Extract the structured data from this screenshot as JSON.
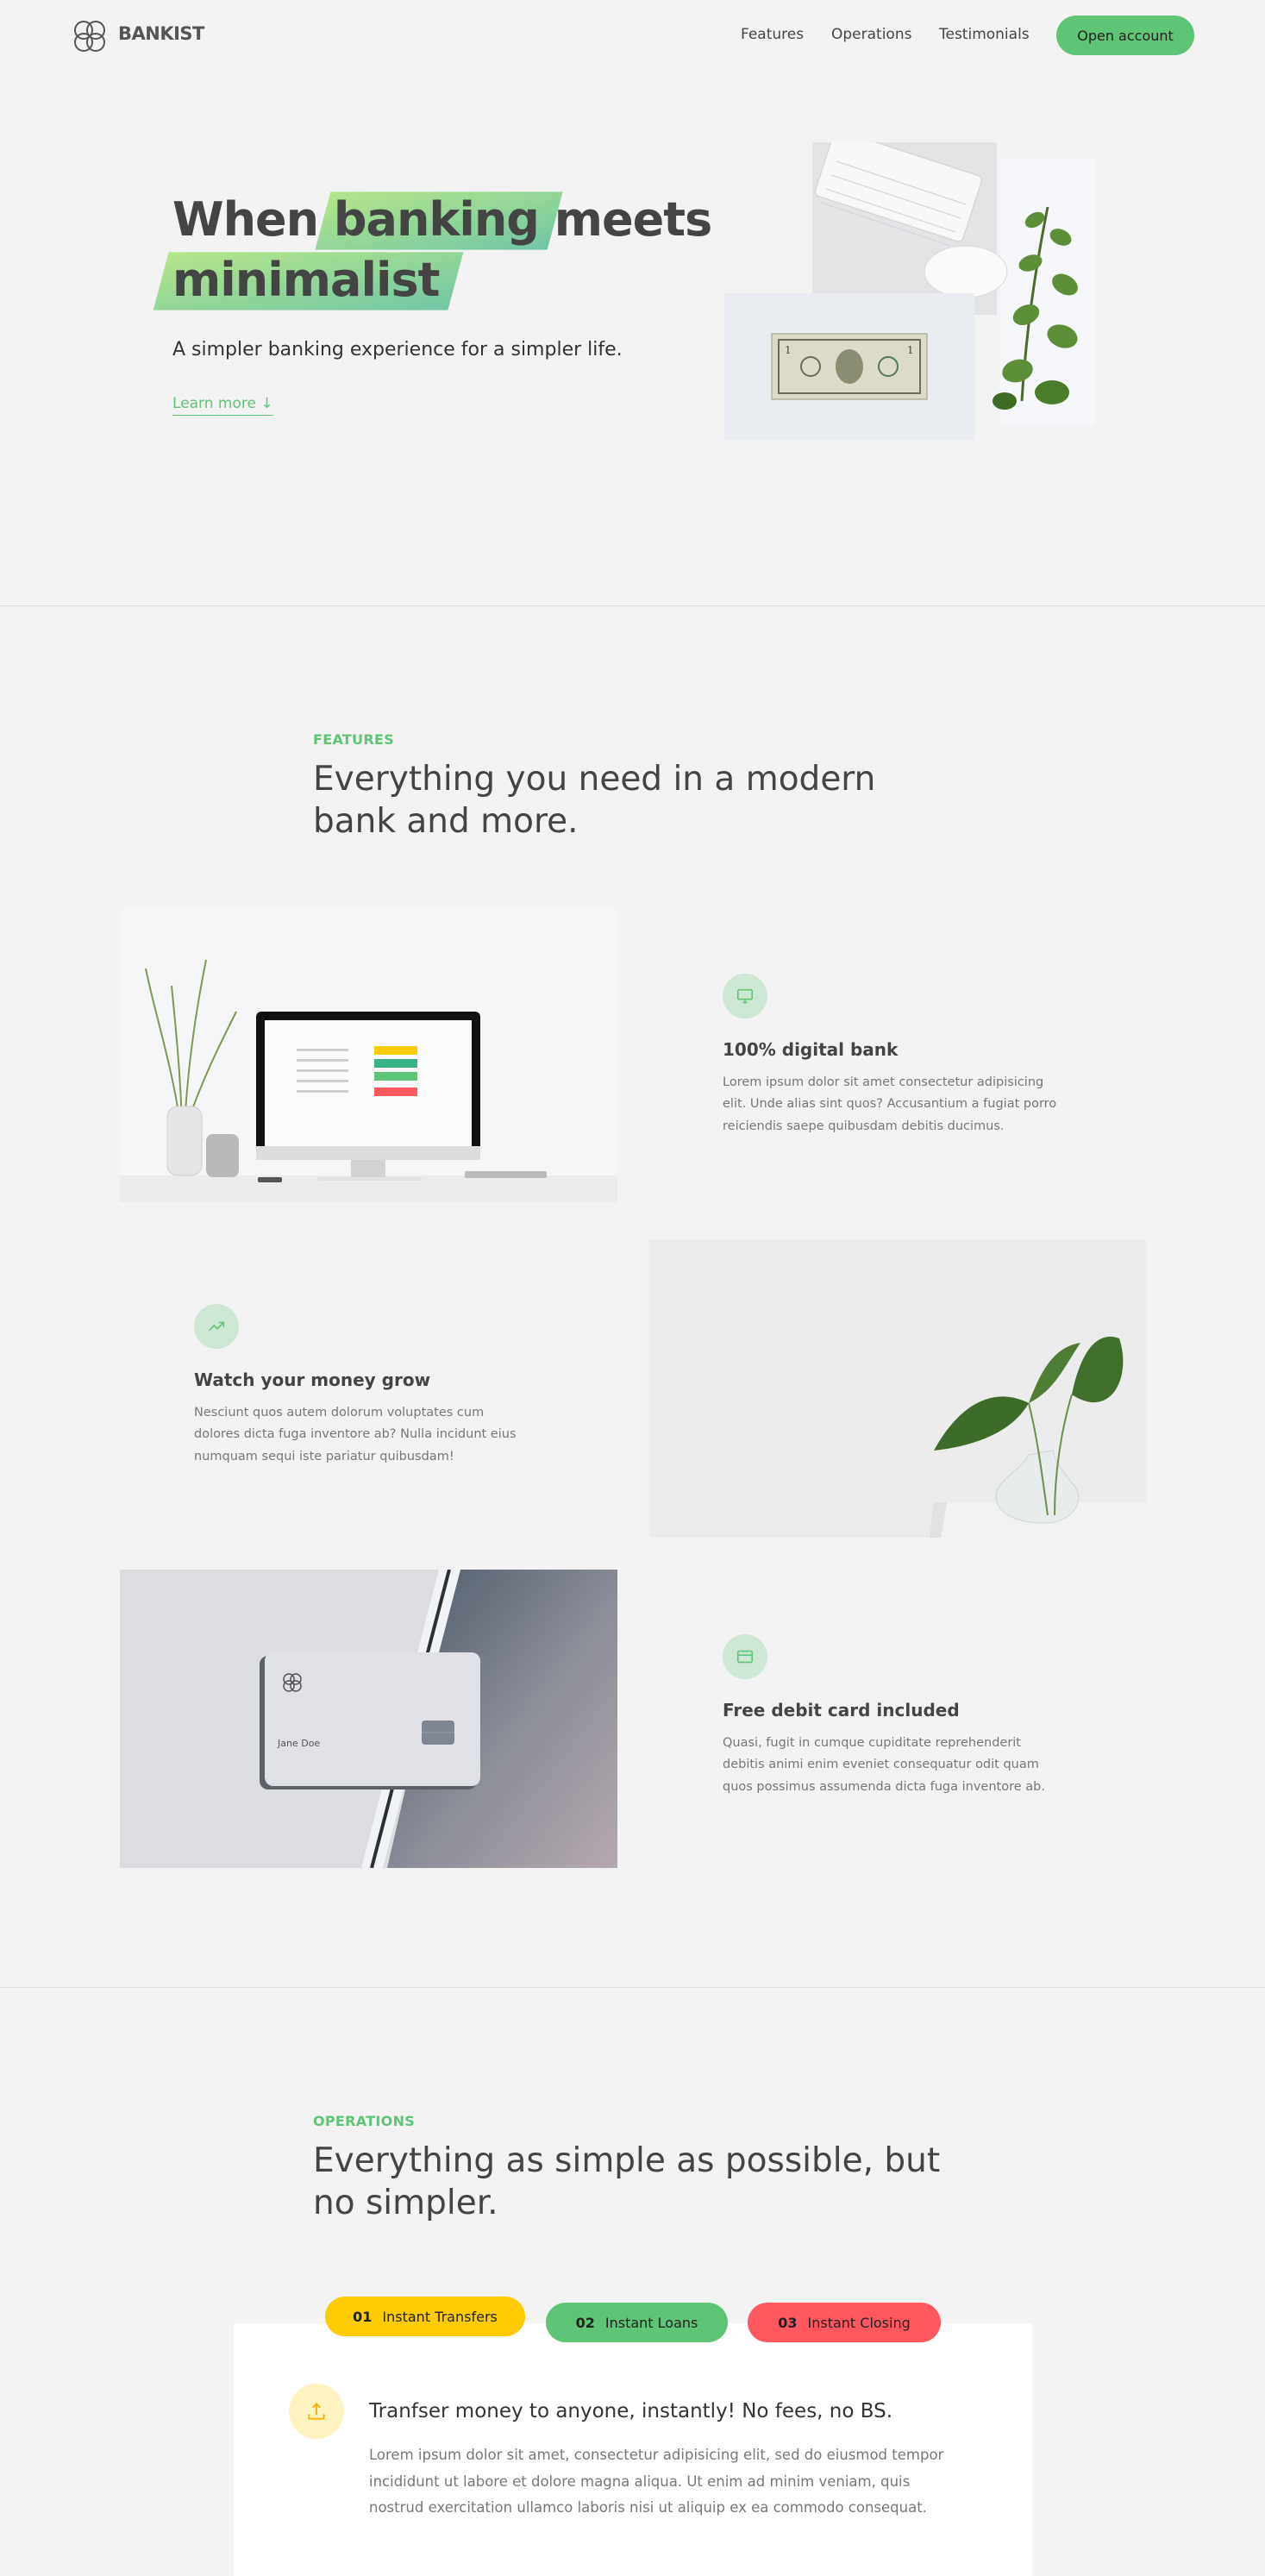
{
  "nav": {
    "logo_text": "BANKIST",
    "links": [
      "Features",
      "Operations",
      "Testimonials"
    ],
    "cta": "Open account"
  },
  "hero": {
    "title_part1": "When",
    "title_highlight1": "banking",
    "title_part2": "meets",
    "title_highlight2": "minimalist",
    "subtitle": "A simpler banking experience for a simpler life.",
    "learn_more": "Learn more ↓"
  },
  "features": {
    "label": "FEATURES",
    "title": "Everything you need in a modern bank and more.",
    "items": [
      {
        "title": "100% digital bank",
        "text": "Lorem ipsum dolor sit amet consectetur adipisicing elit. Unde alias sint quos? Accusantium a fugiat porro reiciendis saepe quibusdam debitis ducimus.",
        "icon": "monitor-icon"
      },
      {
        "title": "Watch your money grow",
        "text": "Nesciunt quos autem dolorum voluptates cum dolores dicta fuga inventore ab? Nulla incidunt eius numquam sequi iste pariatur quibusdam!",
        "icon": "trending-up-icon"
      },
      {
        "title": "Free debit card included",
        "text": "Quasi, fugit in cumque cupiditate reprehenderit debitis animi enim eveniet consequatur odit quam quos possimus assumenda dicta fuga inventore ab.",
        "icon": "credit-card-icon"
      }
    ],
    "card_name": "Jane Doe"
  },
  "operations": {
    "label": "OPERATIONS",
    "title": "Everything as simple as possible, but no simpler.",
    "tabs": [
      {
        "num": "01",
        "label": "Instant Transfers",
        "color": "#ffcb03"
      },
      {
        "num": "02",
        "label": "Instant Loans",
        "color": "#5ec576"
      },
      {
        "num": "03",
        "label": "Instant Closing",
        "color": "#ff585f"
      }
    ],
    "content": {
      "title": "Tranfser money to anyone, instantly! No fees, no BS.",
      "text": "Lorem ipsum dolor sit amet, consectetur adipisicing elit, sed do eiusmod tempor incididunt ut labore et dolore magna aliqua. Ut enim ad minim veniam, quis nostrud exercitation ullamco laboris nisi ut aliquip ex ea commodo consequat.",
      "icon": "upload-icon"
    }
  },
  "colors": {
    "accent_green": "#5ec576",
    "accent_yellow": "#ffcb03",
    "accent_red": "#ff585f",
    "background": "#f3f3f3"
  }
}
